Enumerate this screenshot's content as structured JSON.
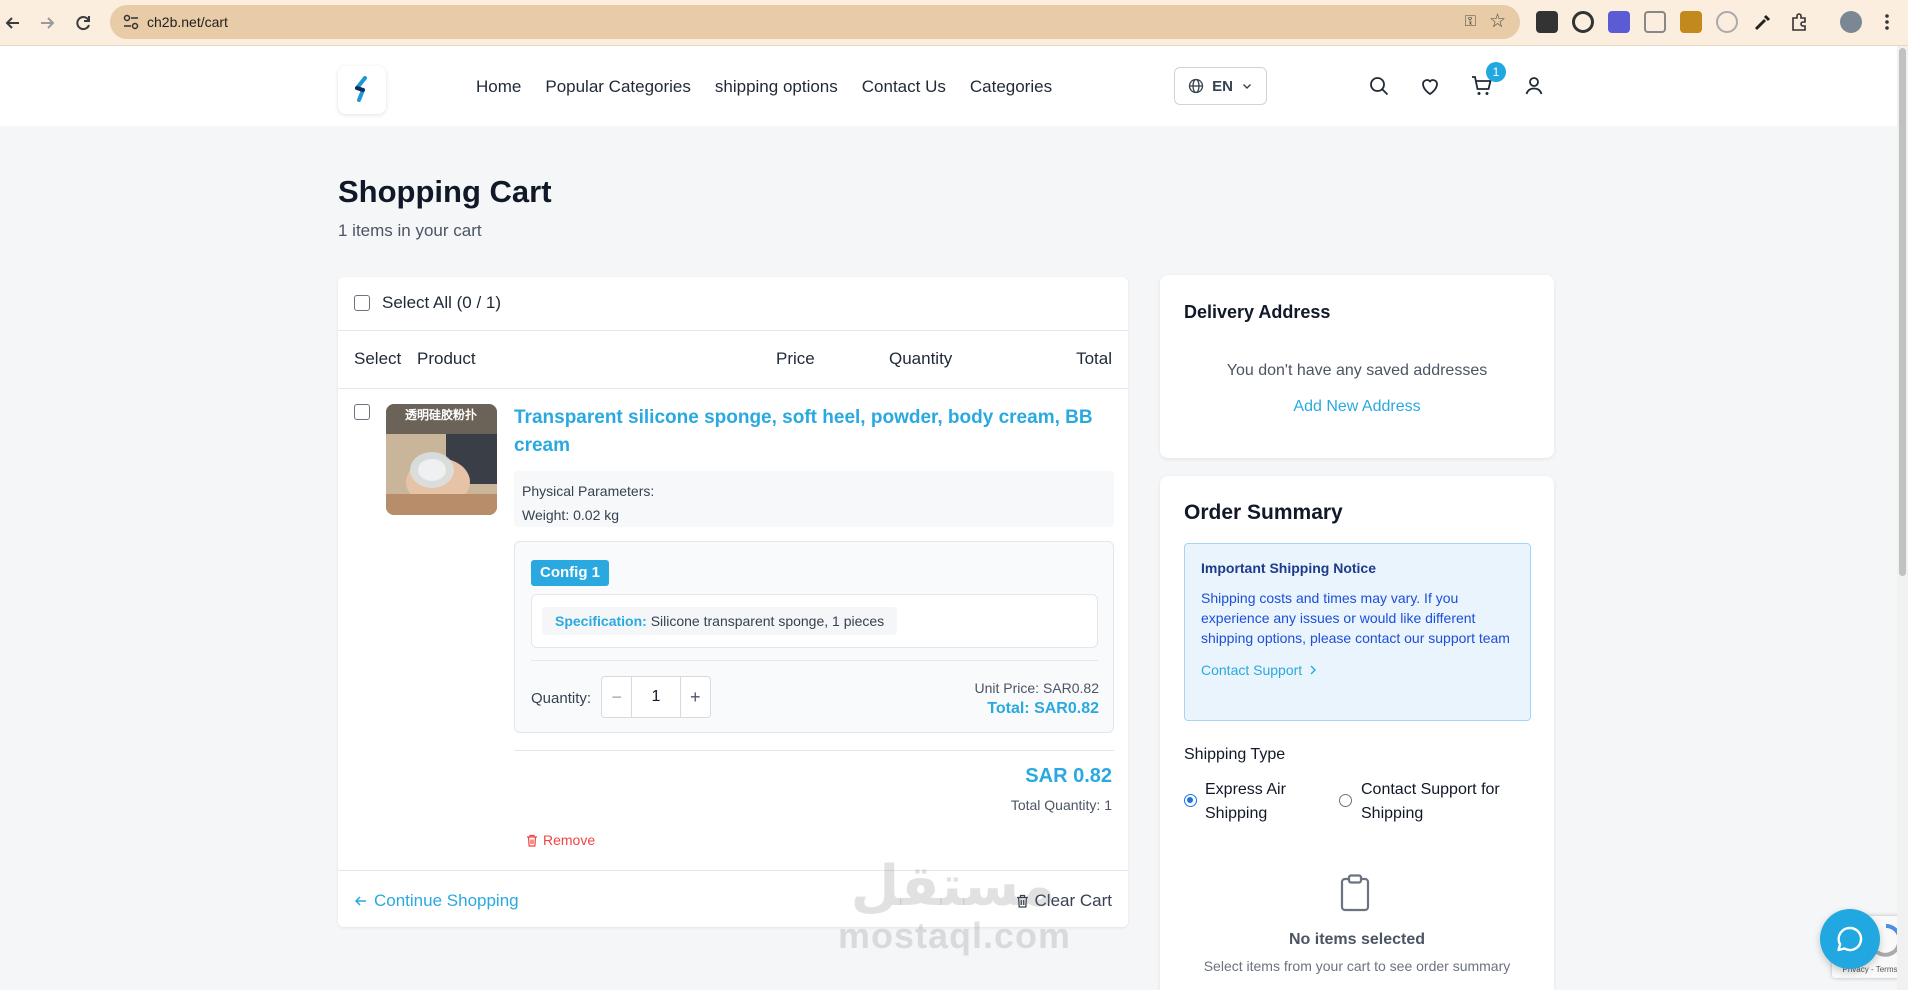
{
  "browser": {
    "url": "ch2b.net/cart",
    "back_icon": "arrow-left-icon",
    "forward_icon": "arrow-right-icon",
    "reload_icon": "reload-icon"
  },
  "header": {
    "nav": [
      "Home",
      "Popular Categories",
      "shipping options",
      "Contact Us",
      "Categories"
    ],
    "language": "EN",
    "cart_count": "1"
  },
  "page": {
    "title": "Shopping Cart",
    "subtitle": "1 items in your cart"
  },
  "cart": {
    "select_all": "Select All (0 / 1)",
    "columns": {
      "select": "Select",
      "product": "Product",
      "price": "Price",
      "quantity": "Quantity",
      "total": "Total"
    },
    "item": {
      "thumb_text": "透明硅胶粉扑",
      "title": "Transparent silicone sponge, soft heel, powder, body cream, BB cream",
      "params_heading": "Physical Parameters:",
      "weight_label": "Weight:",
      "weight_value": "0.02 kg",
      "config_label": "Config 1",
      "spec_label": "Specification:",
      "spec_value": "Silicone transparent sponge, 1 pieces",
      "quantity_label": "Quantity:",
      "quantity_value": "1",
      "unit_price": "Unit Price: SAR0.82",
      "config_total": "Total: SAR0.82",
      "item_total": "SAR 0.82",
      "total_quantity": "Total Quantity: 1",
      "remove_label": "Remove"
    },
    "continue_label": "Continue Shopping",
    "clear_label": "Clear Cart"
  },
  "delivery": {
    "title": "Delivery Address",
    "empty_text": "You don't have any saved addresses",
    "add_label": "Add New Address"
  },
  "summary": {
    "title": "Order Summary",
    "notice_title": "Important Shipping Notice",
    "notice_body": "Shipping costs and times may vary. If you experience any issues or would like different shipping options, please contact our support team",
    "notice_link": "Contact Support",
    "shipping_type_label": "Shipping Type",
    "options": [
      "Express Air Shipping",
      "Contact Support for Shipping"
    ],
    "selected_option": "Express Air Shipping",
    "empty_title": "No items selected",
    "empty_sub": "Select items from your cart to see order summary"
  },
  "watermark": {
    "arabic": "مستقل",
    "latin": "mostaql.com"
  },
  "recaptcha": {
    "footer": "Privacy - Terms"
  },
  "colors": {
    "accent": "#2aa9e0",
    "danger": "#ef4444",
    "badge": "#22a8e0"
  }
}
